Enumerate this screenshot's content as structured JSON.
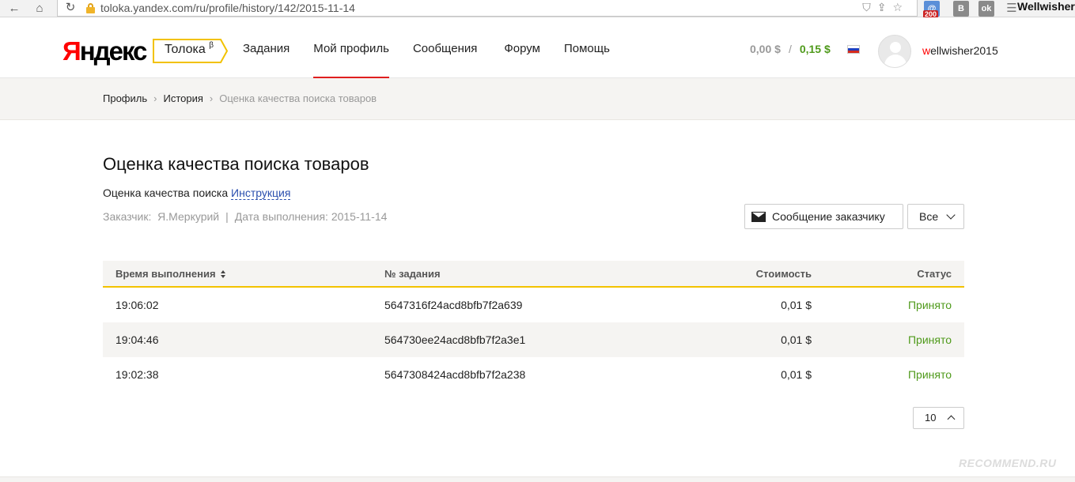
{
  "browser": {
    "url": "toloka.yandex.com/ru/profile/history/142/2015-11-14",
    "mail_badge": "200",
    "ext_vk": "B",
    "ext_ok": "ok",
    "user": "Wellwisher"
  },
  "header": {
    "logo_first": "Я",
    "logo_rest": "ндекс",
    "toloka_label": "Толока",
    "toloka_beta": "β",
    "menu": [
      {
        "label": "Задания"
      },
      {
        "label": "Мой профиль",
        "active": true
      },
      {
        "label": "Сообщения"
      },
      {
        "label": "Форум"
      },
      {
        "label": "Помощь"
      }
    ],
    "balance_pending": "0,00 $",
    "balance_separator": "/",
    "balance_earned": "0,15 $",
    "username_first": "w",
    "username_rest": "ellwisher2015",
    "colors": {
      "accent_red": "#e01f1f",
      "money_green": "#4f9a1b",
      "toloka_yellow": "#f2c200"
    }
  },
  "breadcrumbs": {
    "items": [
      "Профиль",
      "История"
    ],
    "current": "Оценка качества поиска товаров",
    "separator": "›"
  },
  "project": {
    "title": "Оценка качества поиска товаров",
    "description": "Оценка качества поиска",
    "instruction_link": "Инструкция",
    "customer_label": "Заказчик:",
    "customer": "Я.Меркурий",
    "date_label": "Дата выполнения:",
    "date": "2015-11-14",
    "meta_separator": "|",
    "message_button": "Сообщение заказчику",
    "filter_value": "Все"
  },
  "table": {
    "headers": {
      "time": "Время выполнения",
      "task_id": "№ задания",
      "cost": "Стоимость",
      "status": "Статус"
    },
    "rows": [
      {
        "time": "19:06:02",
        "task_id": "5647316f24acd8bfb7f2a639",
        "cost": "0,01 $",
        "status": "Принято"
      },
      {
        "time": "19:04:46",
        "task_id": "564730ee24acd8bfb7f2a3e1",
        "cost": "0,01 $",
        "status": "Принято"
      },
      {
        "time": "19:02:38",
        "task_id": "5647308424acd8bfb7f2a238",
        "cost": "0,01 $",
        "status": "Принято"
      }
    ]
  },
  "pager": {
    "page_size": "10"
  },
  "watermark": "RECOMMEND.RU"
}
